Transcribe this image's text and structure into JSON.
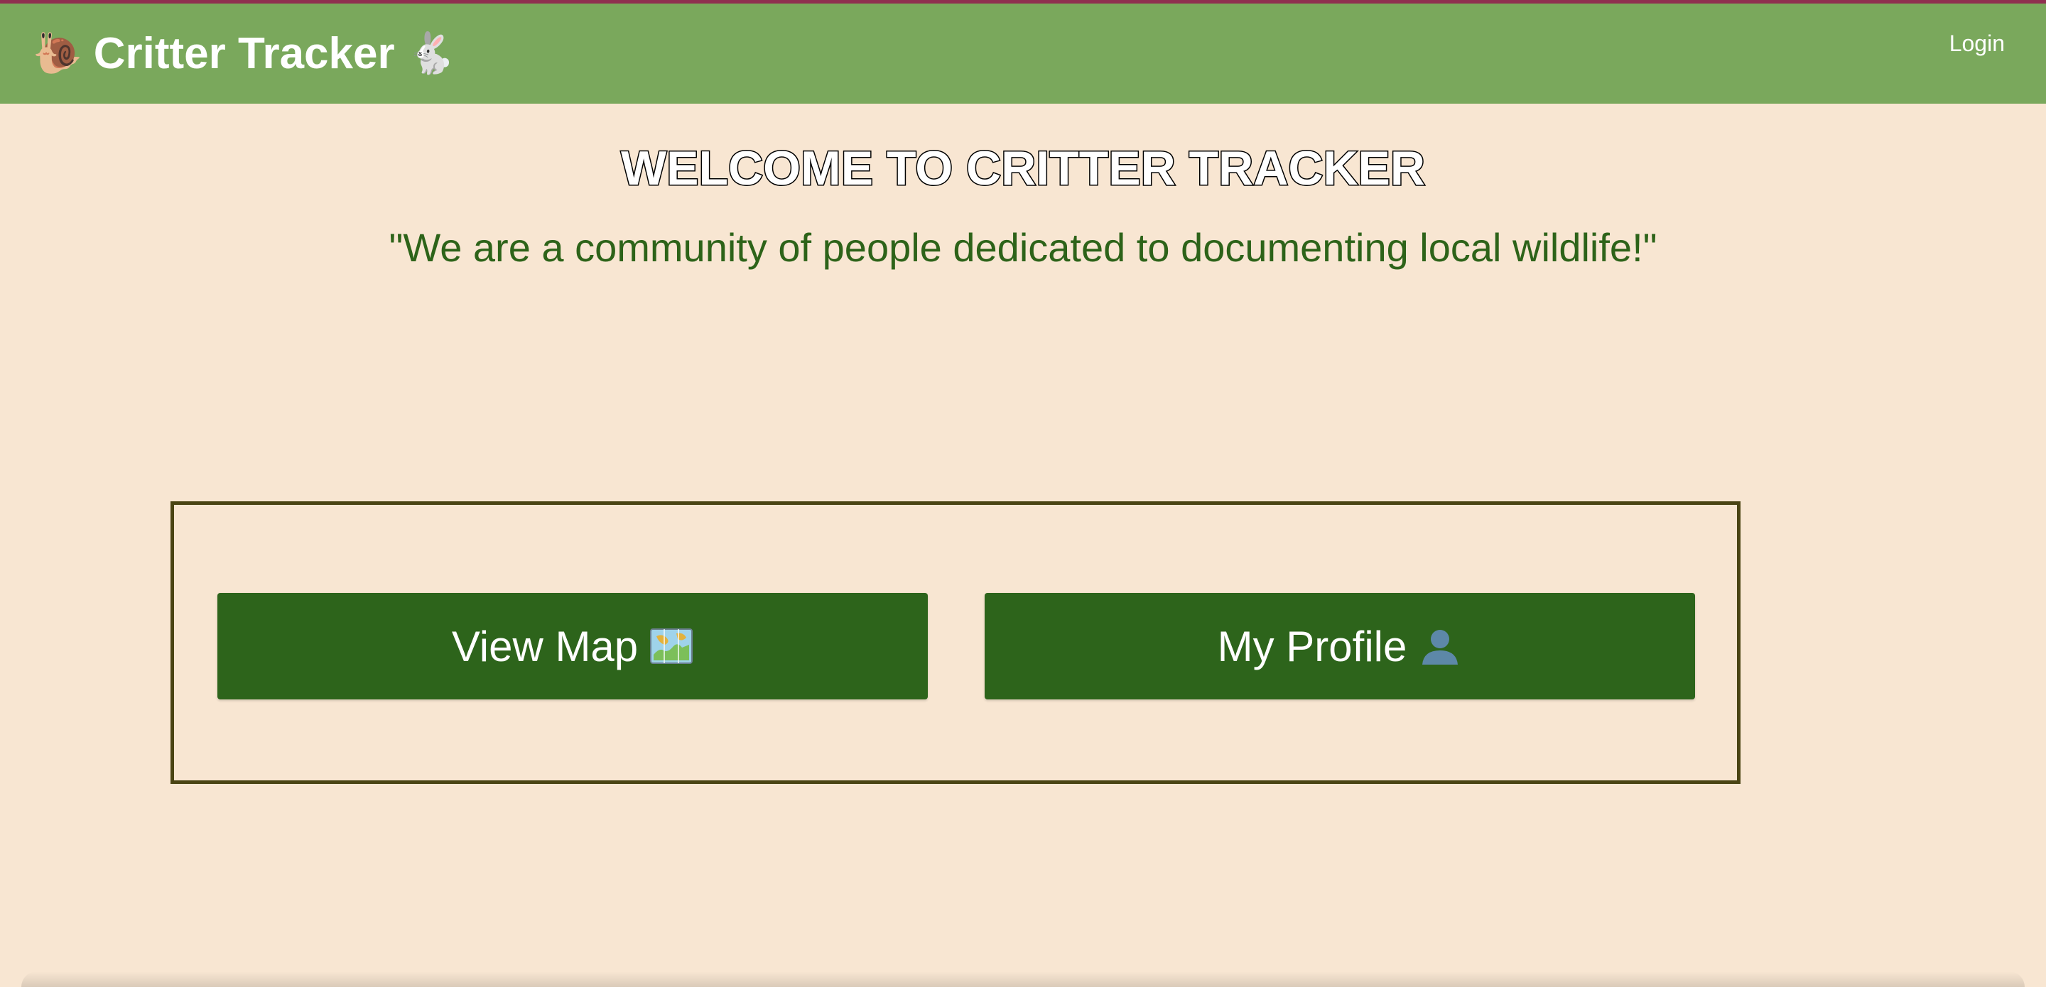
{
  "navbar": {
    "brand": {
      "leading_icon": "snail-icon",
      "title": "Critter Tracker",
      "trailing_icon": "rabbit-icon"
    },
    "login_label": "Login"
  },
  "hero": {
    "title": "WELCOME TO CRITTER TRACKER",
    "tagline": "\"We are a community of people dedicated to documenting local wildlife!\""
  },
  "actions": {
    "view_map": {
      "label": "View Map",
      "icon": "map-icon"
    },
    "my_profile": {
      "label": "My Profile",
      "icon": "user-silhouette-icon"
    }
  },
  "colors": {
    "page_background": "#f8e6d2",
    "navbar_background": "#7aa85c",
    "top_stripe": "#8f2f4f",
    "button_background": "#2d641b",
    "tagline_text": "#2d6319",
    "panel_border": "#4a4413"
  }
}
